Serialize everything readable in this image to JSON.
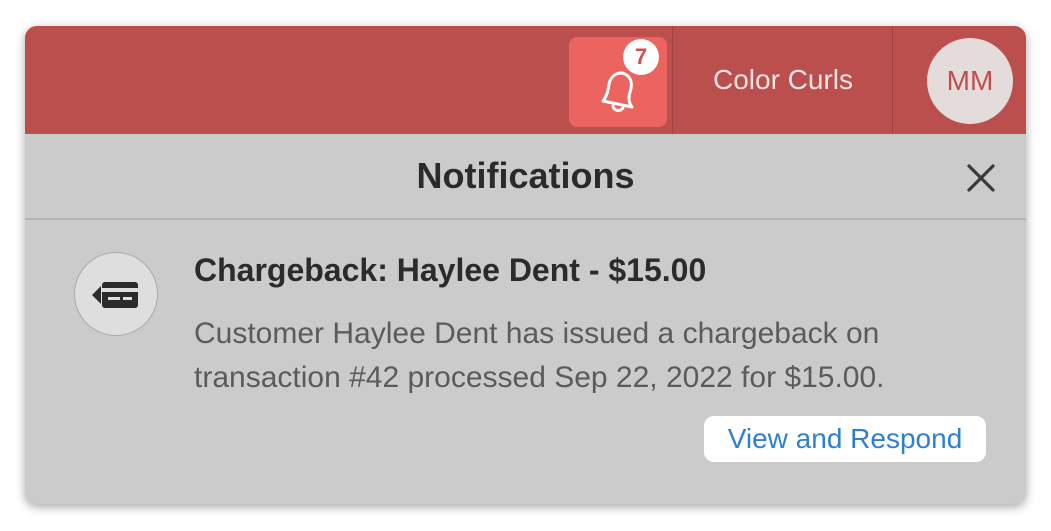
{
  "topbar": {
    "notification_count": "7",
    "org_name": "Color Curls",
    "user_initials": "MM",
    "colors": {
      "bar": "#bb4f4d",
      "bell_button": "#eb6460"
    }
  },
  "panel": {
    "title": "Notifications",
    "close_icon": "close-icon"
  },
  "notifications": [
    {
      "icon": "credit-card-chargeback-icon",
      "title": "Chargeback: Haylee Dent - $15.00",
      "body": "Customer Haylee Dent has issued a chargeback on transaction #42 processed Sep 22, 2022 for $15.00.",
      "action_label": "View and Respond",
      "action_color": "#2f7fd1"
    }
  ]
}
